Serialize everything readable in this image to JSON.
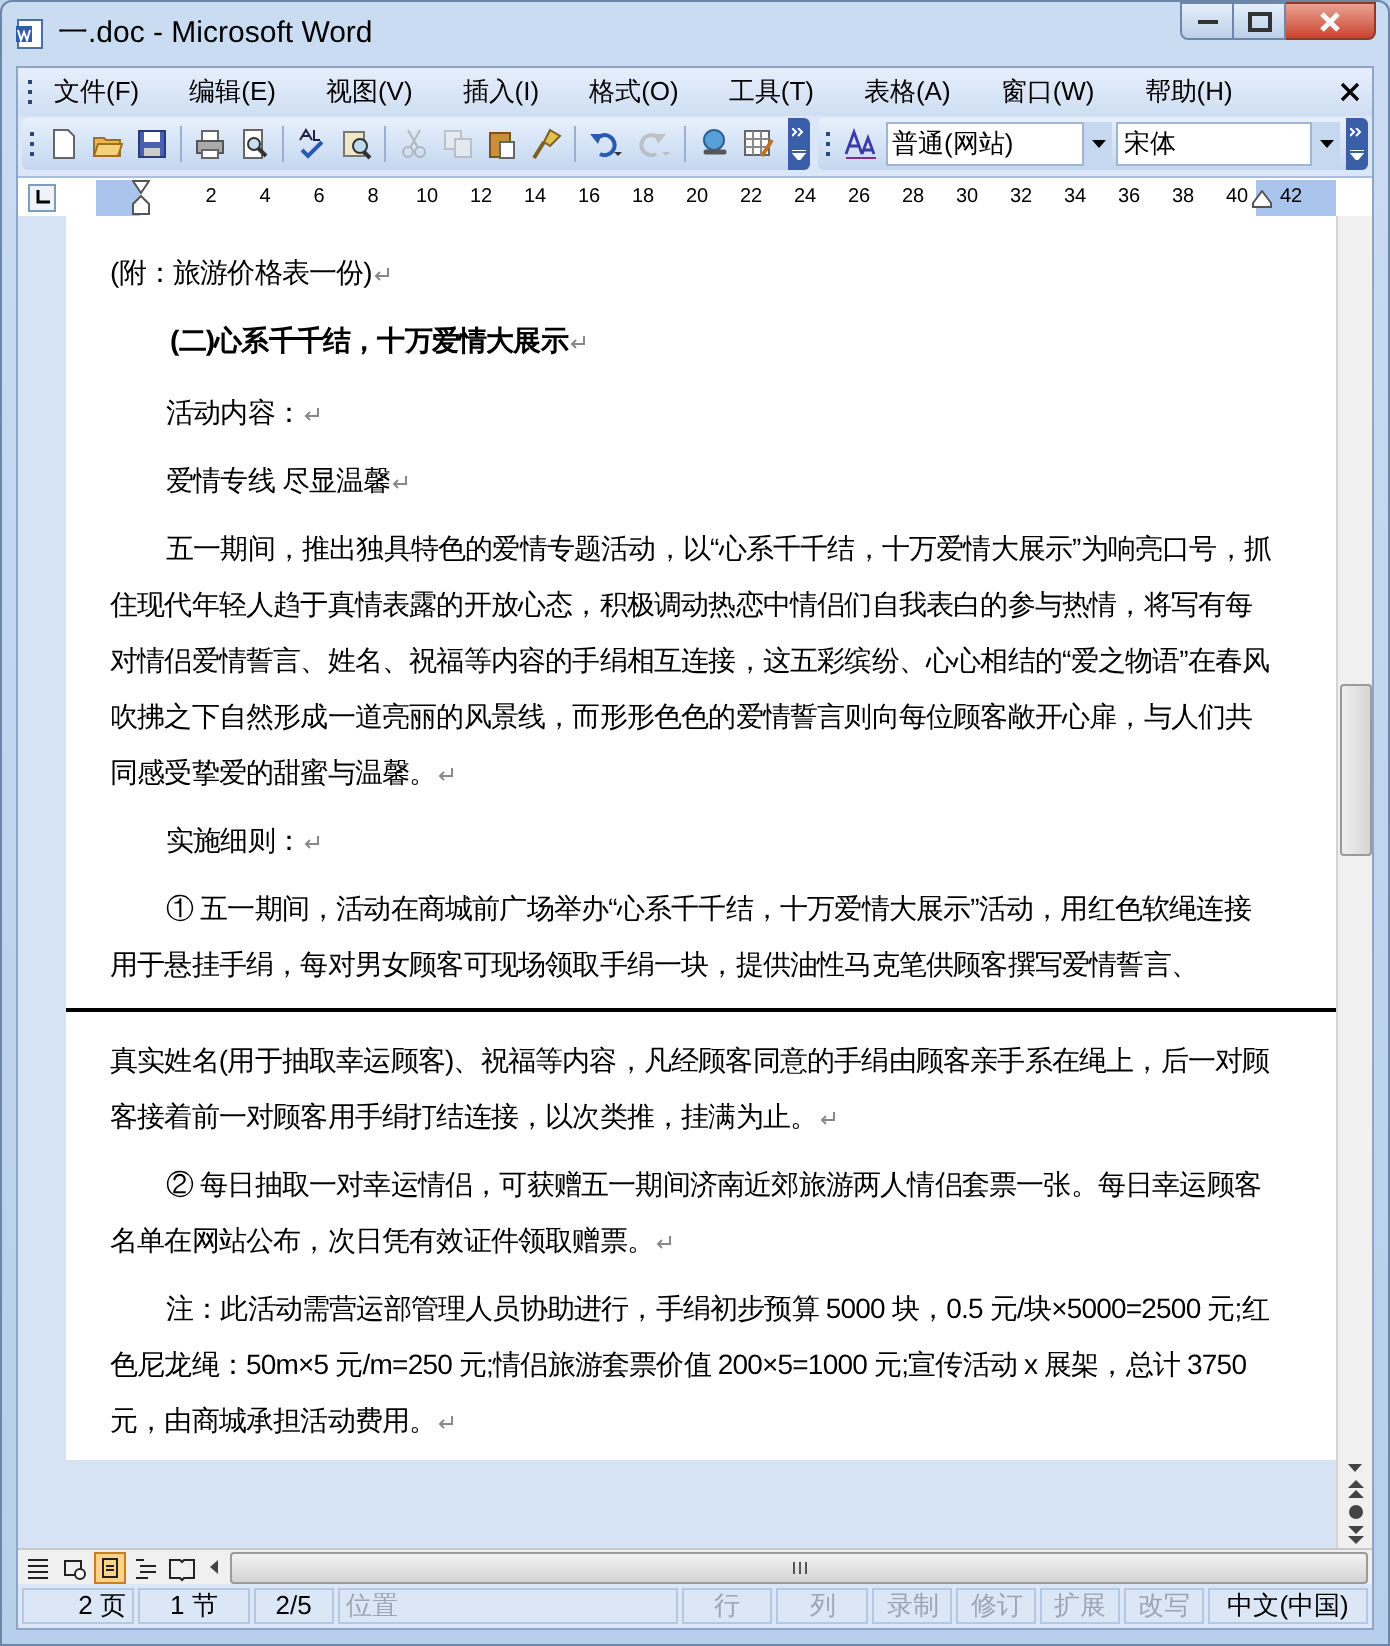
{
  "window": {
    "title": "一.doc - Microsoft Word"
  },
  "menu": [
    "文件(F)",
    "编辑(E)",
    "视图(V)",
    "插入(I)",
    "格式(O)",
    "工具(T)",
    "表格(A)",
    "窗口(W)",
    "帮助(H)"
  ],
  "toolbar": {
    "buttons": [
      {
        "kind": "new",
        "disabled": false
      },
      {
        "kind": "open",
        "disabled": false
      },
      {
        "kind": "save",
        "disabled": false
      },
      {
        "kind": "sep"
      },
      {
        "kind": "print",
        "disabled": false
      },
      {
        "kind": "preview",
        "disabled": false
      },
      {
        "kind": "sep"
      },
      {
        "kind": "spelling",
        "disabled": false
      },
      {
        "kind": "research",
        "disabled": false
      },
      {
        "kind": "sep"
      },
      {
        "kind": "cut",
        "disabled": true
      },
      {
        "kind": "copy",
        "disabled": true
      },
      {
        "kind": "paste",
        "disabled": false
      },
      {
        "kind": "painter",
        "disabled": false
      },
      {
        "kind": "sep"
      },
      {
        "kind": "undo",
        "disabled": false
      },
      {
        "kind": "redo",
        "disabled": true
      },
      {
        "kind": "sep"
      },
      {
        "kind": "link",
        "disabled": false
      },
      {
        "kind": "table",
        "disabled": false
      }
    ],
    "style": "普通(网站)",
    "font": "宋体"
  },
  "ruler": [
    "2",
    "4",
    "6",
    "8",
    "10",
    "12",
    "14",
    "16",
    "18",
    "20",
    "22",
    "24",
    "26",
    "28",
    "30",
    "32",
    "34",
    "36",
    "38",
    "40",
    "42"
  ],
  "pages": [
    {
      "paragraphs": [
        {
          "kind": "plain",
          "text": "(附：旅游价格表一份)",
          "end_mark": true
        },
        {
          "kind": "heading",
          "text": "(二)心系千千结，十万爱情大展示",
          "end_mark": true
        },
        {
          "kind": "indented",
          "text": "活动内容：",
          "end_mark": true
        },
        {
          "kind": "indented",
          "text": "爱情专线 尽显温馨",
          "end_mark": true
        },
        {
          "kind": "indented",
          "text": "五一期间，推出独具特色的爱情专题活动，以“心系千千结，十万爱情大展示”为响亮口号，抓住现代年轻人趋于真情表露的开放心态，积极调动热恋中情侣们自我表白的参与热情，将写有每对情侣爱情誓言、姓名、祝福等内容的手绢相互连接，这五彩缤纷、心心相结的“爱之物语”在春风吹拂之下自然形成一道亮丽的风景线，而形形色色的爱情誓言则向每位顾客敞开心扉，与人们共同感受挚爱的甜蜜与温馨。",
          "end_mark": true
        },
        {
          "kind": "indented",
          "text": "实施细则：",
          "end_mark": true
        },
        {
          "kind": "indented",
          "text": "① 五一期间，活动在商城前广场举办“心系千千结，十万爱情大展示”活动，用红色软绳连接用于悬挂手绢，每对男女顾客可现场领取手绢一块，提供油性马克笔供顾客撰写爱情誓言、",
          "end_mark": false
        }
      ]
    },
    {
      "paragraphs": [
        {
          "kind": "plain",
          "text": "真实姓名(用于抽取幸运顾客)、祝福等内容，凡经顾客同意的手绢由顾客亲手系在绳上，后一对顾客接着前一对顾客用手绢打结连接，以次类推，挂满为止。",
          "end_mark": true
        },
        {
          "kind": "indented",
          "text": "② 每日抽取一对幸运情侣，可获赠五一期间济南近郊旅游两人情侣套票一张。每日幸运顾客名单在网站公布，次日凭有效证件领取赠票。",
          "end_mark": true
        },
        {
          "kind": "indented",
          "text": "注：此活动需营运部管理人员协助进行，手绢初步预算 5000 块，0.5 元/块×5000=2500 元;红色尼龙绳：50m×5 元/m=250 元;情侣旅游套票价值 200×5=1000 元;宣传活动 x 展架，总计 3750 元，由商城承担活动费用。",
          "end_mark": true
        }
      ]
    }
  ],
  "view_buttons": [
    {
      "kind": "normal",
      "selected": false
    },
    {
      "kind": "web",
      "selected": false
    },
    {
      "kind": "print",
      "selected": true
    },
    {
      "kind": "outline",
      "selected": false
    },
    {
      "kind": "reading",
      "selected": false
    }
  ],
  "status_bar": [
    {
      "text": "2 页",
      "disabled": false
    },
    {
      "text": "1 节",
      "disabled": false
    },
    {
      "text": "2/5",
      "disabled": false
    },
    {
      "text": "位置",
      "disabled": true
    },
    {
      "text": "行",
      "disabled": true
    },
    {
      "text": "列",
      "disabled": true
    },
    {
      "text": "录制",
      "disabled": true
    },
    {
      "text": "修订",
      "disabled": true
    },
    {
      "text": "扩展",
      "disabled": true
    },
    {
      "text": "改写",
      "disabled": true
    },
    {
      "text": "中文(中国)",
      "disabled": false
    }
  ]
}
